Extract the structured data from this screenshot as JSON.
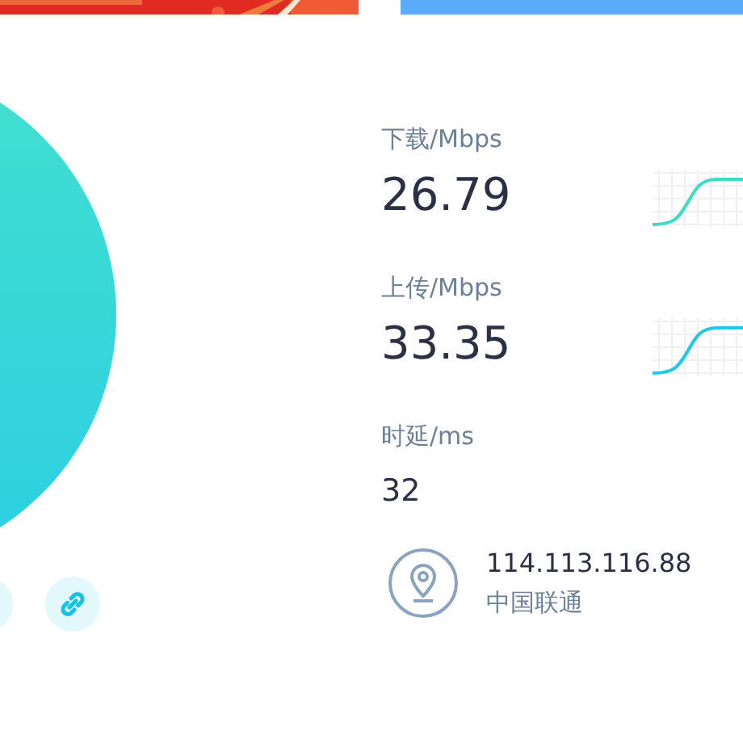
{
  "banners": [
    {
      "kind": "picture"
    },
    {
      "kind": "bar"
    }
  ],
  "stats": [
    {
      "kind": "speed",
      "label": "下载/Mbps",
      "value": "26.79",
      "color": "#3ddcc4"
    },
    {
      "kind": "speed",
      "label": "上传/Mbps",
      "value": "33.35",
      "color": "#1ec8e6"
    },
    {
      "kind": "latency",
      "label": "时延/ms",
      "value": "32"
    }
  ],
  "actions": [
    {
      "kind": "plain"
    },
    {
      "kind": "link"
    }
  ],
  "network": {
    "ip": "114.113.116.88",
    "isp": "中国联通"
  }
}
